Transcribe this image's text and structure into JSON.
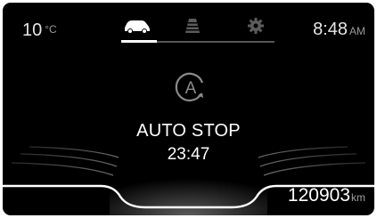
{
  "status_bar": {
    "temperature": "10",
    "temperature_unit": "°C",
    "time": "8:48",
    "time_period": "AM"
  },
  "tabs": [
    {
      "icon": "car-icon",
      "active": true
    },
    {
      "icon": "road-icon",
      "active": false
    },
    {
      "icon": "gear-icon",
      "active": false
    }
  ],
  "main": {
    "mode_icon": "auto-stop-icon",
    "status": "AUTO STOP",
    "timer": "23:47"
  },
  "odometer": {
    "value": "120903",
    "unit": "km"
  },
  "colors": {
    "background": "#000000",
    "text": "#ffffff",
    "inactive_icon": "#6a6a6a"
  }
}
